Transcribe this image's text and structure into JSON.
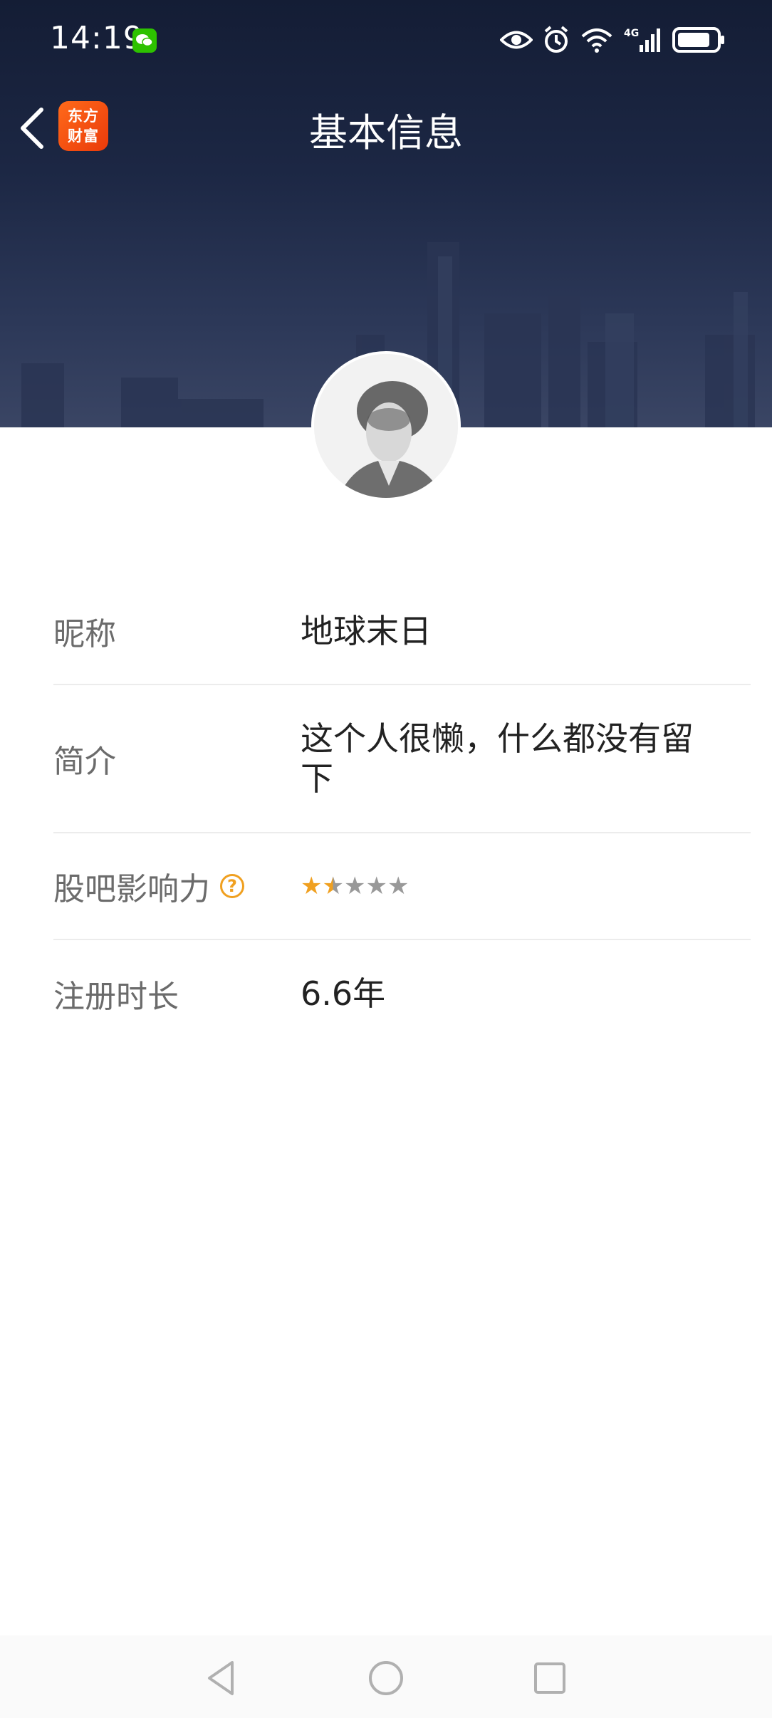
{
  "status_bar": {
    "time": "14:19",
    "icons": [
      "wechat-icon",
      "eye-icon",
      "alarm-icon",
      "wifi-icon",
      "signal-4g-icon",
      "battery-icon"
    ],
    "network_label": "4G"
  },
  "nav": {
    "title": "基本信息",
    "app_logo_line1": "东方",
    "app_logo_line2": "财富"
  },
  "profile": {
    "rows": [
      {
        "label": "昵称",
        "value": "地球末日"
      },
      {
        "label": "简介",
        "value": "这个人很懒，什么都没有留下"
      },
      {
        "label": "股吧影响力",
        "help": "?",
        "rating": 1.5,
        "max_rating": 5
      },
      {
        "label": "注册时长",
        "value": "6.6年"
      }
    ]
  },
  "colors": {
    "header_bg": "#1c2744",
    "star_active": "#f0a020",
    "star_inactive": "#999999",
    "logo_bg": "#ff5a14"
  }
}
